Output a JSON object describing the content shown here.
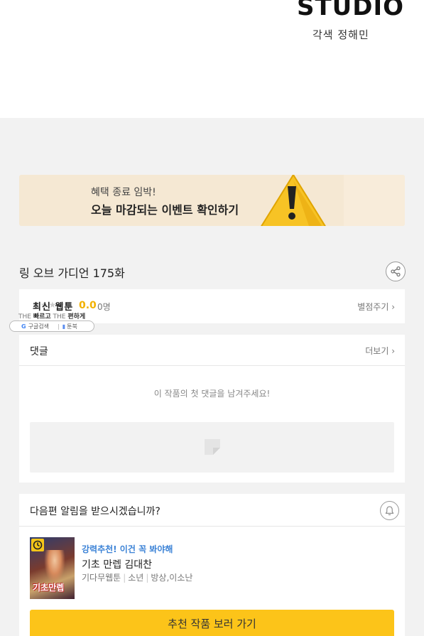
{
  "header": {
    "studio_logo": "STUDIO",
    "credit": "각색 정해민"
  },
  "banner": {
    "line1": "혜택 종료 임박!",
    "line2": "오늘 마감되는 이벤트 확인하기",
    "icon": "warning-icon",
    "accent": "#fcc419"
  },
  "episode": {
    "title": "링 오브 가디언 175화",
    "share_icon": "share-icon"
  },
  "rating": {
    "stars": "★★★★★",
    "score": "0.0",
    "count": "0명",
    "rate_link": "별점주기 ›"
  },
  "overlay": {
    "title": "최신 웹툰",
    "sub_the1": "THE",
    "sub_fast": "빠르고",
    "sub_the2": "THE",
    "sub_easy": "편하게",
    "pill_google": "G",
    "pill_google_label": "구글검색",
    "pill_toonbook_label": "툰북"
  },
  "comments": {
    "title": "댓글",
    "more": "더보기 ›",
    "empty": "이 작품의 첫 댓글을 남겨주세요!"
  },
  "notify": {
    "question": "다음편 알림을 받으시겠습니까?",
    "bell_icon": "bell-icon"
  },
  "recommend": {
    "label": "강력추천! 이건 꼭 봐야해",
    "title": "기초 만렙 김대찬",
    "meta": [
      "기다무웹툰",
      "소년",
      "방상,이소난"
    ],
    "thumb_text": "기초만렙",
    "cta": "추천 작품 보러 가기",
    "cta_color": "#fcc419",
    "label_color": "#3b82d6"
  }
}
